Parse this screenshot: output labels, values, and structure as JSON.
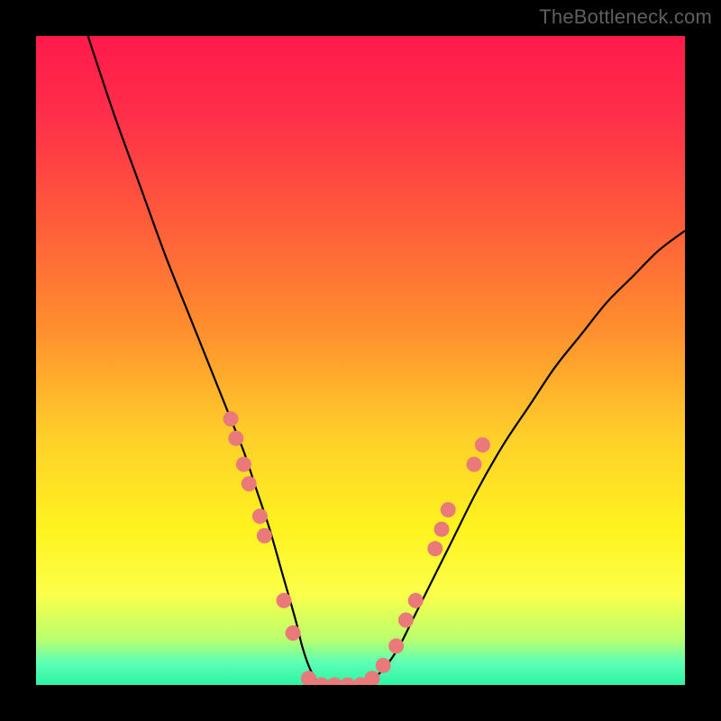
{
  "watermark": "TheBottleneck.com",
  "colors": {
    "frame": "#000000",
    "curve": "#000000",
    "dot_fill": "#e97a79",
    "dot_stroke": "#d66",
    "gradient_stops": [
      {
        "offset": 0.0,
        "color": "#ff1a4b"
      },
      {
        "offset": 0.12,
        "color": "#ff2e4a"
      },
      {
        "offset": 0.28,
        "color": "#ff5a3b"
      },
      {
        "offset": 0.45,
        "color": "#ff8e2e"
      },
      {
        "offset": 0.62,
        "color": "#ffd02a"
      },
      {
        "offset": 0.76,
        "color": "#fff31f"
      },
      {
        "offset": 0.86,
        "color": "#fbff4a"
      },
      {
        "offset": 0.93,
        "color": "#baff6e"
      },
      {
        "offset": 0.965,
        "color": "#5dffb5"
      },
      {
        "offset": 1.0,
        "color": "#2ef3a5"
      }
    ]
  },
  "chart_data": {
    "type": "line",
    "title": "",
    "xlabel": "",
    "ylabel": "",
    "xlim": [
      0,
      100
    ],
    "ylim": [
      0,
      100
    ],
    "grid": false,
    "legend": false,
    "series": [
      {
        "name": "bottleneck-curve",
        "x": [
          8,
          12,
          16,
          20,
          24,
          28,
          30,
          32,
          34,
          36,
          38,
          40,
          41,
          42,
          43,
          44,
          46,
          48,
          50,
          52,
          54,
          56,
          58,
          60,
          64,
          68,
          72,
          76,
          80,
          84,
          88,
          92,
          96,
          100
        ],
        "y": [
          100,
          88,
          77,
          66,
          56,
          46,
          41,
          36,
          30,
          24,
          17,
          10,
          6,
          3,
          1,
          0,
          0,
          0,
          0,
          1,
          3,
          6,
          10,
          14,
          22,
          30,
          37,
          43,
          49,
          54,
          59,
          63,
          67,
          70
        ]
      }
    ],
    "marker_points": {
      "name": "highlight-dots",
      "points": [
        {
          "x": 30.0,
          "y": 41
        },
        {
          "x": 30.8,
          "y": 38
        },
        {
          "x": 32.0,
          "y": 34
        },
        {
          "x": 32.8,
          "y": 31
        },
        {
          "x": 34.5,
          "y": 26
        },
        {
          "x": 35.2,
          "y": 23
        },
        {
          "x": 38.2,
          "y": 13
        },
        {
          "x": 39.6,
          "y": 8
        },
        {
          "x": 42.0,
          "y": 1
        },
        {
          "x": 44.0,
          "y": 0
        },
        {
          "x": 46.0,
          "y": 0
        },
        {
          "x": 48.0,
          "y": 0
        },
        {
          "x": 50.0,
          "y": 0
        },
        {
          "x": 51.8,
          "y": 1
        },
        {
          "x": 53.5,
          "y": 3
        },
        {
          "x": 55.5,
          "y": 6
        },
        {
          "x": 57.0,
          "y": 10
        },
        {
          "x": 58.5,
          "y": 13
        },
        {
          "x": 61.5,
          "y": 21
        },
        {
          "x": 62.5,
          "y": 24
        },
        {
          "x": 63.5,
          "y": 27
        },
        {
          "x": 67.5,
          "y": 34
        },
        {
          "x": 68.8,
          "y": 37
        }
      ]
    }
  }
}
